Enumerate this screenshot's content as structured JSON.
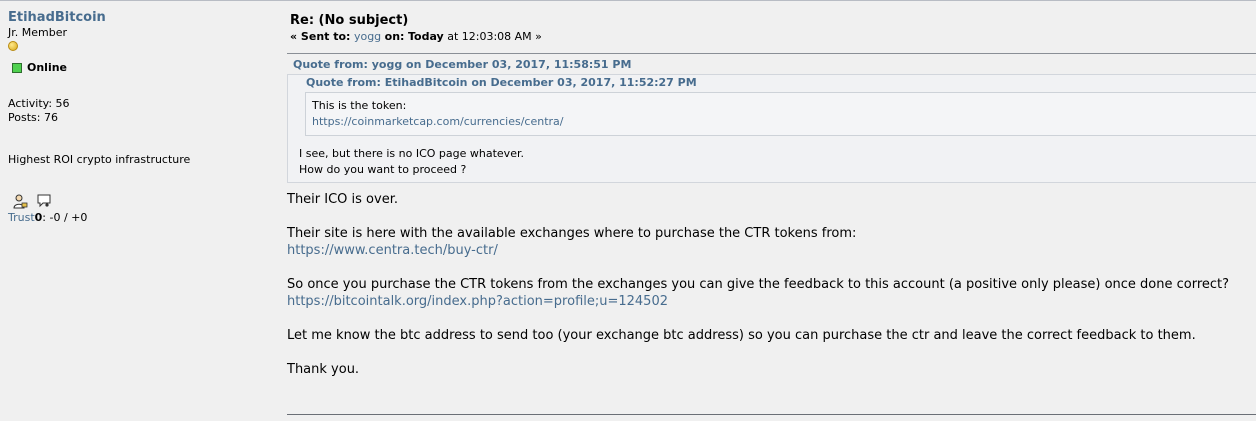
{
  "poster": {
    "username": "EtihadBitcoin",
    "rank": "Jr. Member",
    "status": "Online",
    "activity_label": "Activity:",
    "activity_value": "56",
    "posts_label": "Posts:",
    "posts_value": "76",
    "personal_text": "Highest ROI crypto infrastructure",
    "trust_label": "Trust",
    "trust_score": "0",
    "trust_rest": ": -0 / +0",
    "icons": [
      "profile-icon",
      "message-icon"
    ],
    "colors": {
      "username": "#476c8e",
      "online": "#4fd14f"
    }
  },
  "post": {
    "subject": "Re: (No subject)",
    "sent_prefix": "« Sent to:",
    "sent_to": "yogg",
    "on_label": "on:",
    "date_bold": "Today",
    "time": "at 12:03:08 AM »",
    "quote_outer": {
      "header": "Quote from: yogg on December 03, 2017, 11:58:51 PM",
      "inner_header": "Quote from: EtihadBitcoin on December 03, 2017, 11:52:27 PM",
      "inner_text": "This is the token:",
      "inner_link": "https://coinmarketcap.com/currencies/centra/",
      "line1": "I see, but there is no ICO page whatever.",
      "line2": "How do you want to proceed ?"
    },
    "p1": "Their ICO is over.",
    "p2": "Their site is here with the available exchanges where to purchase the CTR tokens from:",
    "link2": "https://www.centra.tech/buy-ctr/",
    "p3": "So once you purchase the CTR tokens from the exchanges you can give the feedback to this account (a positive only please) once done correct?",
    "link3": "https://bitcointalk.org/index.php?action=profile;u=124502",
    "p4": "Let me know the btc address to send too (your exchange btc address) so you can purchase the ctr and leave the correct feedback to them.",
    "p5": "Thank you."
  }
}
